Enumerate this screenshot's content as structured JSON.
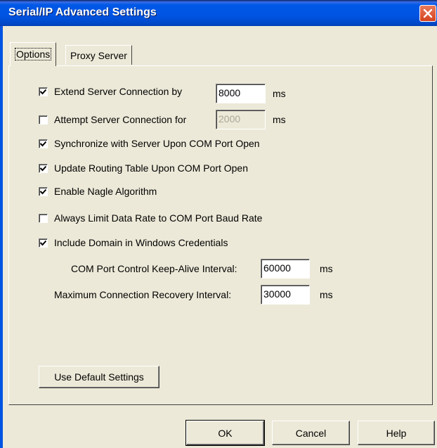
{
  "window": {
    "title": "Serial/IP Advanced Settings"
  },
  "tabs": [
    {
      "label": "Options",
      "active": true
    },
    {
      "label": "Proxy Server",
      "active": false
    }
  ],
  "options": {
    "extend_server": {
      "label": "Extend Server Connection by",
      "checked": true,
      "value": "8000",
      "unit": "ms"
    },
    "attempt_server": {
      "label": "Attempt Server Connection for",
      "checked": false,
      "value": "2000",
      "unit": "ms",
      "disabled": true
    },
    "synchronize": {
      "label": "Synchronize with Server Upon COM Port Open",
      "checked": true
    },
    "update_routing": {
      "label": "Update Routing Table Upon COM Port Open",
      "checked": true
    },
    "nagle": {
      "label": "Enable Nagle Algorithm",
      "checked": true
    },
    "limit_rate": {
      "label": "Always Limit Data Rate to COM Port Baud Rate",
      "checked": false
    },
    "include_domain": {
      "label": "Include Domain in Windows Credentials",
      "checked": true
    },
    "keep_alive": {
      "label": "COM Port Control Keep-Alive Interval:",
      "value": "60000",
      "unit": "ms"
    },
    "recovery": {
      "label": "Maximum Connection Recovery Interval:",
      "value": "30000",
      "unit": "ms"
    }
  },
  "buttons": {
    "use_default": "Use Default Settings",
    "ok": "OK",
    "cancel": "Cancel",
    "help": "Help"
  },
  "colors": {
    "title_bar": "#0054e3",
    "dialog_bg": "#ece9d8",
    "close_button": "#d5431f"
  }
}
